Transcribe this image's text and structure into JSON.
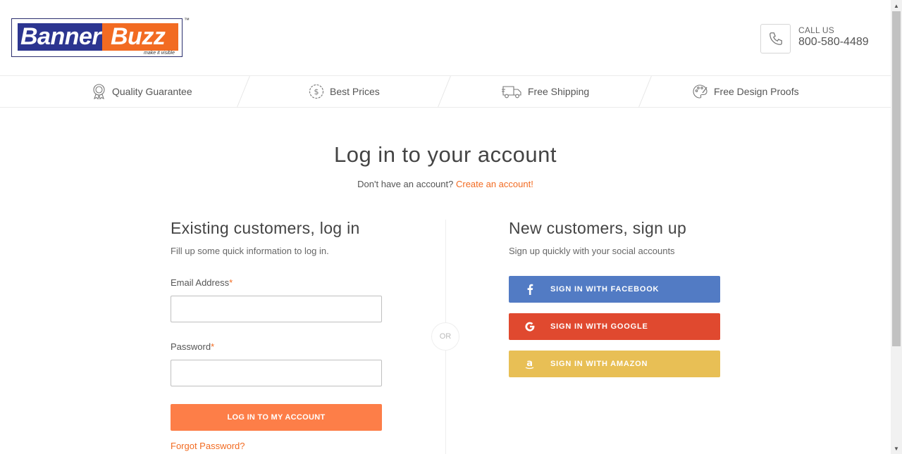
{
  "brand": {
    "word1": "Banner",
    "word2": "Buzz",
    "tagline": "make it visible",
    "tm": "™",
    "color_blue": "#2c3590",
    "color_orange": "#f26b22"
  },
  "contact": {
    "label": "CALL US",
    "phone": "800-580-4489",
    "icon": "phone-icon"
  },
  "features": [
    {
      "label": "Quality Guarantee",
      "icon": "award-badge-icon"
    },
    {
      "label": "Best Prices",
      "icon": "dollar-coin-icon"
    },
    {
      "label": "Free Shipping",
      "icon": "truck-icon"
    },
    {
      "label": "Free Design Proofs",
      "icon": "palette-icon"
    }
  ],
  "page": {
    "title": "Log in to your account",
    "no_account_text": "Don't have an account?",
    "create_account_link": "Create an account!"
  },
  "login": {
    "title": "Existing customers, log in",
    "subtitle": "Fill up some quick information to log in.",
    "email_label": "Email Address",
    "password_label": "Password",
    "required_mark": "*",
    "email_value": "",
    "password_value": "",
    "submit_label": "LOG IN TO MY ACCOUNT",
    "forgot_label": "Forgot Password?"
  },
  "divider_text": "OR",
  "signup": {
    "title": "New customers, sign up",
    "subtitle": "Sign up quickly with your social accounts",
    "facebook_label": "SIGN IN WITH FACEBOOK",
    "google_label": "SIGN IN WITH GOOGLE",
    "amazon_label": "SIGN IN WITH AMAZON",
    "facebook_color": "#527bc4",
    "google_color": "#e0492f",
    "amazon_color": "#e8bf55"
  },
  "accent_color": "#f26b22",
  "button_color": "#fd7e48"
}
